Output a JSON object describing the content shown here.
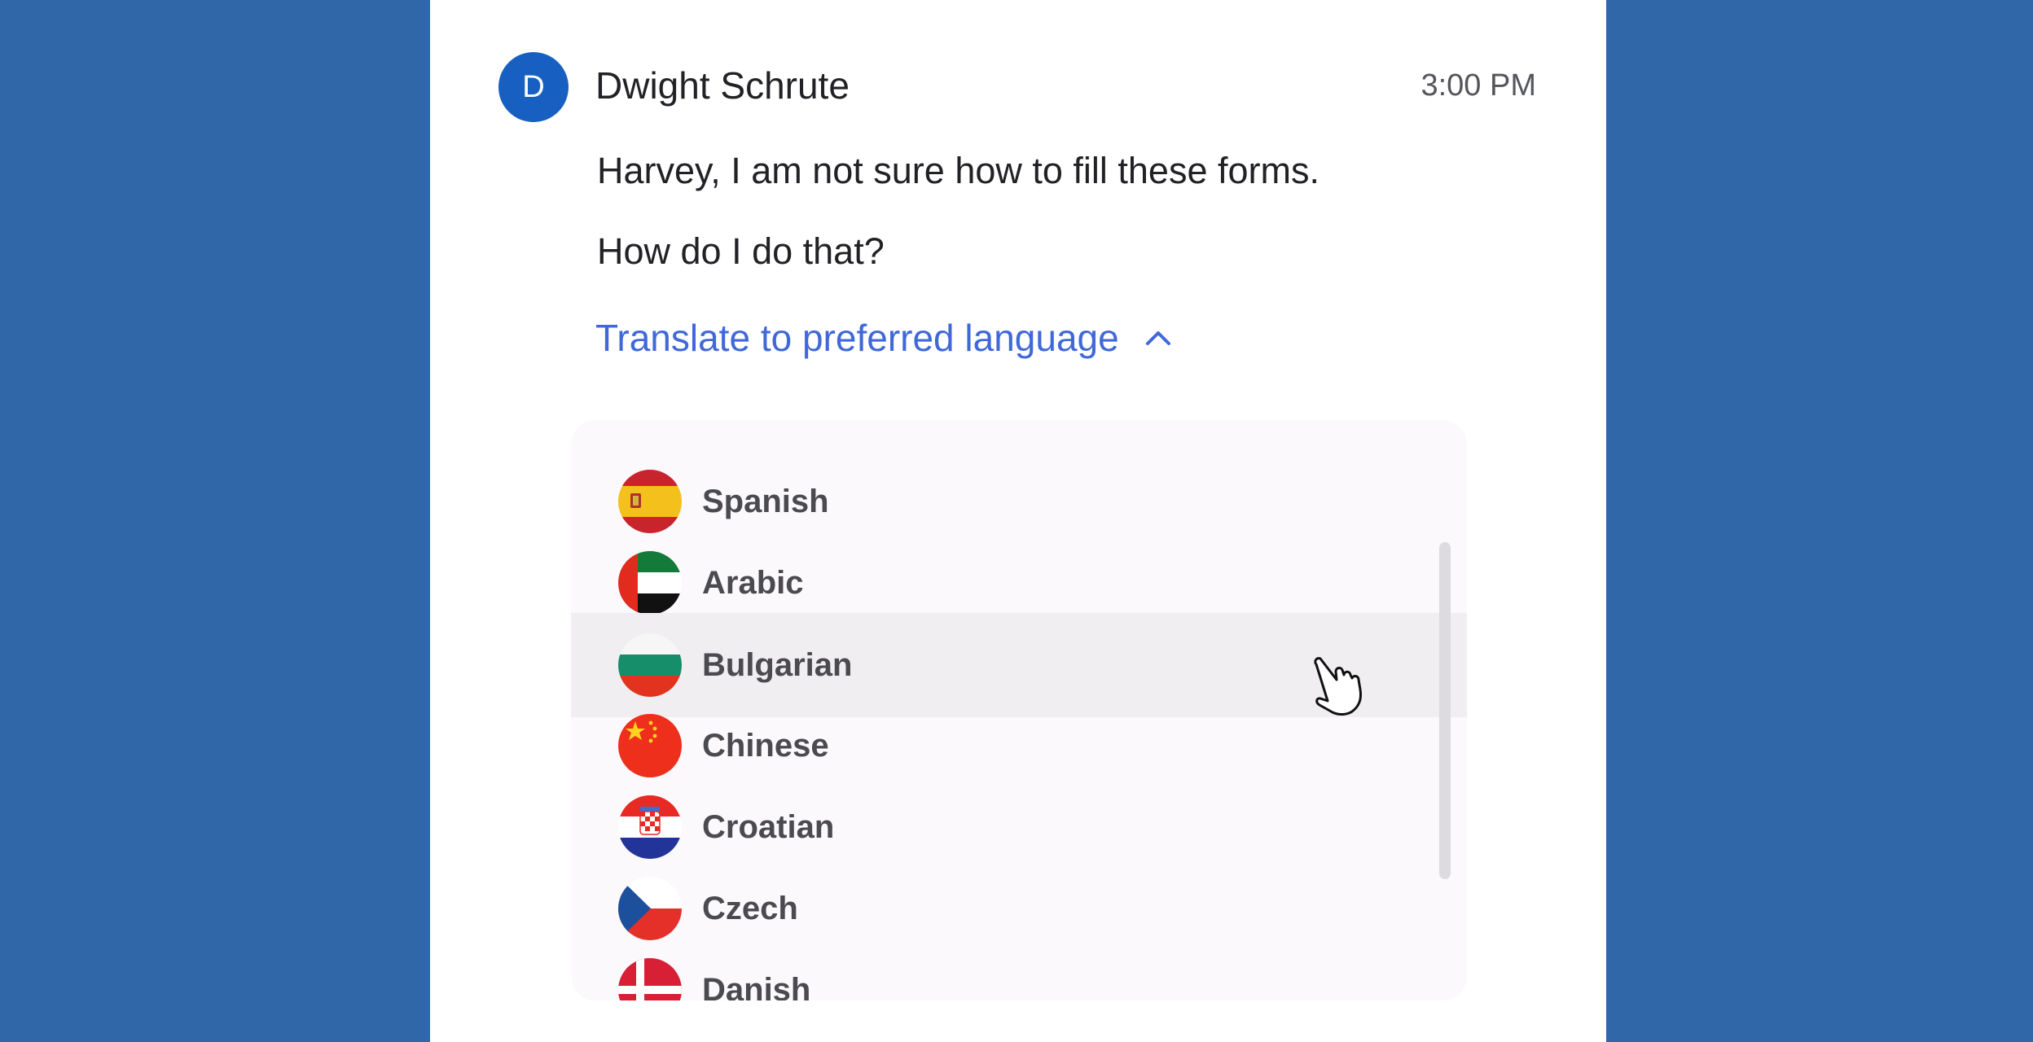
{
  "message": {
    "avatar_initial": "D",
    "sender": "Dwight Schrute",
    "time": "3:00 PM",
    "lines": [
      "Harvey, I am not sure how to fill these forms.",
      "How do I do that?"
    ]
  },
  "translate": {
    "label": "Translate to preferred language",
    "icon": "chevron-up-icon",
    "accent_color": "#4068d8"
  },
  "languages": [
    {
      "label": "Spanish",
      "flag": "spain-flag-icon"
    },
    {
      "label": "Arabic",
      "flag": "uae-flag-icon"
    },
    {
      "label": "Bulgarian",
      "flag": "bulgaria-flag-icon",
      "hovered": true
    },
    {
      "label": "Chinese",
      "flag": "china-flag-icon"
    },
    {
      "label": "Croatian",
      "flag": "croatia-flag-icon"
    },
    {
      "label": "Czech",
      "flag": "czech-flag-icon"
    },
    {
      "label": "Danish",
      "flag": "denmark-flag-icon"
    }
  ],
  "colors": {
    "background": "#2f67a9",
    "avatar": "#1760c1"
  }
}
